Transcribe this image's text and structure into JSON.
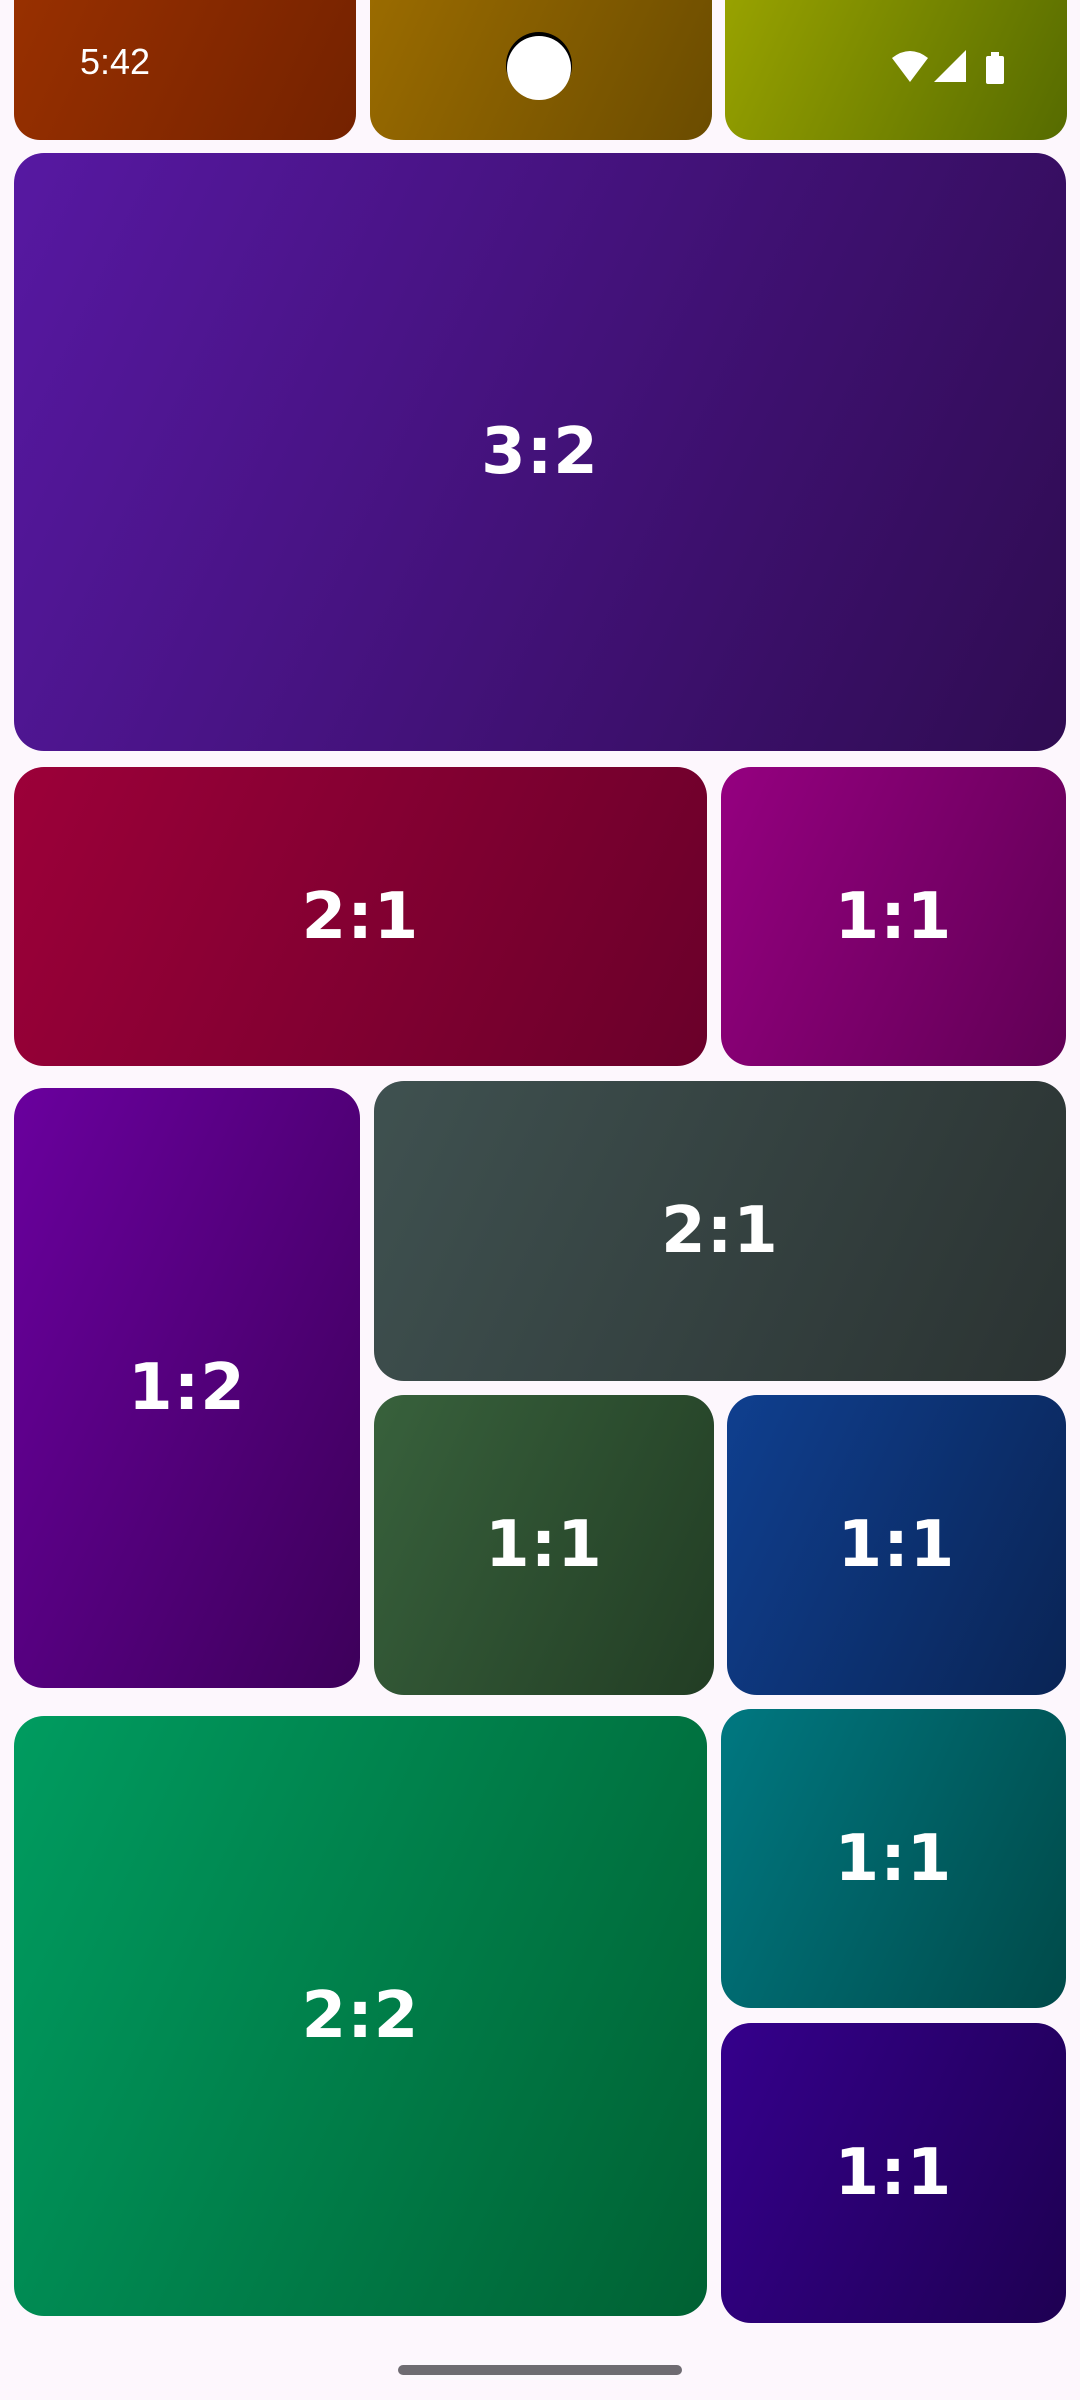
{
  "status_bar": {
    "time": "5:42",
    "icons": [
      "wifi-icon",
      "cellular-signal-icon",
      "battery-icon"
    ]
  },
  "top_tiles": [
    {
      "name": "top-tile-left",
      "gradient": [
        "#983000",
        "#742200"
      ]
    },
    {
      "name": "top-tile-center",
      "gradient": [
        "#9a6b00",
        "#6b4c00"
      ]
    },
    {
      "name": "top-tile-right",
      "gradient": [
        "#98a200",
        "#566b00"
      ]
    }
  ],
  "tiles": [
    {
      "name": "tile-3-2",
      "label": "3:2",
      "gradient": [
        "#5718a2",
        "#2f0c52"
      ]
    },
    {
      "name": "tile-2-1-a",
      "label": "2:1",
      "gradient": [
        "#9c0039",
        "#6a002a"
      ]
    },
    {
      "name": "tile-1-1-a",
      "label": "1:1",
      "gradient": [
        "#950080",
        "#610055"
      ]
    },
    {
      "name": "tile-1-2",
      "label": "1:2",
      "gradient": [
        "#6a009e",
        "#3d005a"
      ]
    },
    {
      "name": "tile-2-1-b",
      "label": "2:1",
      "gradient": [
        "#3f5150",
        "#2b3332"
      ]
    },
    {
      "name": "tile-1-1-b",
      "label": "1:1",
      "gradient": [
        "#38613c",
        "#223d24"
      ]
    },
    {
      "name": "tile-1-1-c",
      "label": "1:1",
      "gradient": [
        "#0f3f8f",
        "#0a2455"
      ]
    },
    {
      "name": "tile-2-2",
      "label": "2:2",
      "gradient": [
        "#009c60",
        "#006133"
      ]
    },
    {
      "name": "tile-1-1-d",
      "label": "1:1",
      "gradient": [
        "#007881",
        "#004a49"
      ]
    },
    {
      "name": "tile-1-1-e",
      "label": "1:1",
      "gradient": [
        "#35008c",
        "#1e0052"
      ]
    }
  ],
  "colors": {
    "background": "#fdf7fd",
    "label_text": "#ffffff",
    "gesture_bar": "#6f6b72"
  }
}
